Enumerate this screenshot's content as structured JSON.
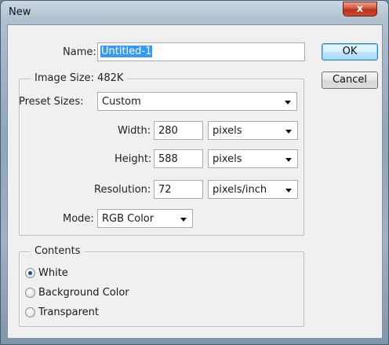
{
  "window": {
    "title": "New",
    "close_glyph": "x"
  },
  "form": {
    "name_label": "Name:",
    "name_value": "Untitled-1",
    "image_size_label": "Image Size: 482K",
    "preset_label": "Preset Sizes:",
    "preset_value": "Custom",
    "width_label": "Width:",
    "width_value": "280",
    "width_unit": "pixels",
    "height_label": "Height:",
    "height_value": "588",
    "height_unit": "pixels",
    "resolution_label": "Resolution:",
    "resolution_value": "72",
    "resolution_unit": "pixels/inch",
    "mode_label": "Mode:",
    "mode_value": "RGB Color"
  },
  "contents": {
    "title": "Contents",
    "options": [
      "White",
      "Background Color",
      "Transparent"
    ],
    "selected": "White"
  },
  "buttons": {
    "ok": "OK",
    "cancel": "Cancel"
  },
  "icons": {
    "close": "close-icon",
    "dropdown": "chevron-down-icon",
    "radio": "radio-button"
  }
}
